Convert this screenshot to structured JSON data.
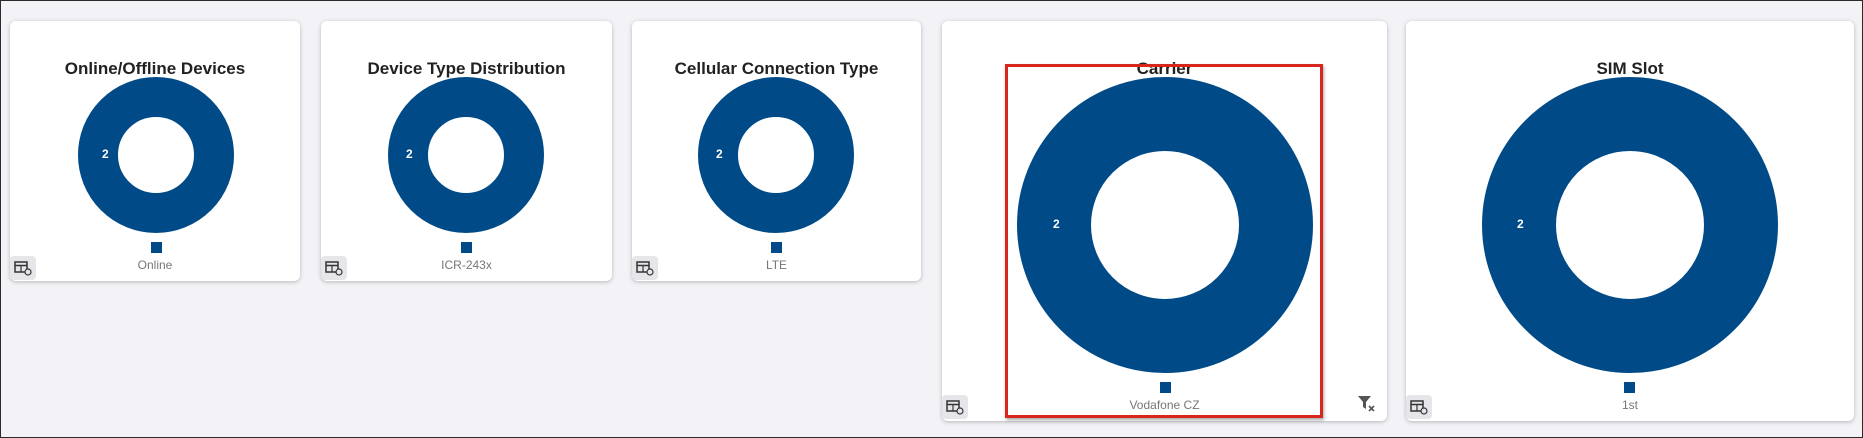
{
  "colors": {
    "accent": "#004b87",
    "highlight": "#d9261c"
  },
  "cards": [
    {
      "title": "Online/Offline Devices",
      "chart_data": {
        "type": "pie",
        "donut": true,
        "categories": [
          "Online"
        ],
        "values": [
          2
        ]
      },
      "legend": "Online",
      "table_icon": "table-refresh-icon"
    },
    {
      "title": "Device Type Distribution",
      "chart_data": {
        "type": "pie",
        "donut": true,
        "categories": [
          "ICR-243x"
        ],
        "values": [
          2
        ]
      },
      "legend": "ICR-243x",
      "table_icon": "table-refresh-icon"
    },
    {
      "title": "Cellular Connection Type",
      "chart_data": {
        "type": "pie",
        "donut": true,
        "categories": [
          "LTE"
        ],
        "values": [
          2
        ]
      },
      "legend": "LTE",
      "table_icon": "table-refresh-icon"
    },
    {
      "title": "Carrier",
      "chart_data": {
        "type": "pie",
        "donut": true,
        "categories": [
          "Vodafone CZ"
        ],
        "values": [
          2
        ]
      },
      "legend": "Vodafone CZ",
      "table_icon": "table-refresh-icon",
      "filter_icon": "filter-clear-icon",
      "highlighted": true
    },
    {
      "title": "SIM Slot",
      "chart_data": {
        "type": "pie",
        "donut": true,
        "categories": [
          "1st"
        ],
        "values": [
          2
        ]
      },
      "legend": "1st",
      "table_icon": "table-refresh-icon"
    }
  ]
}
